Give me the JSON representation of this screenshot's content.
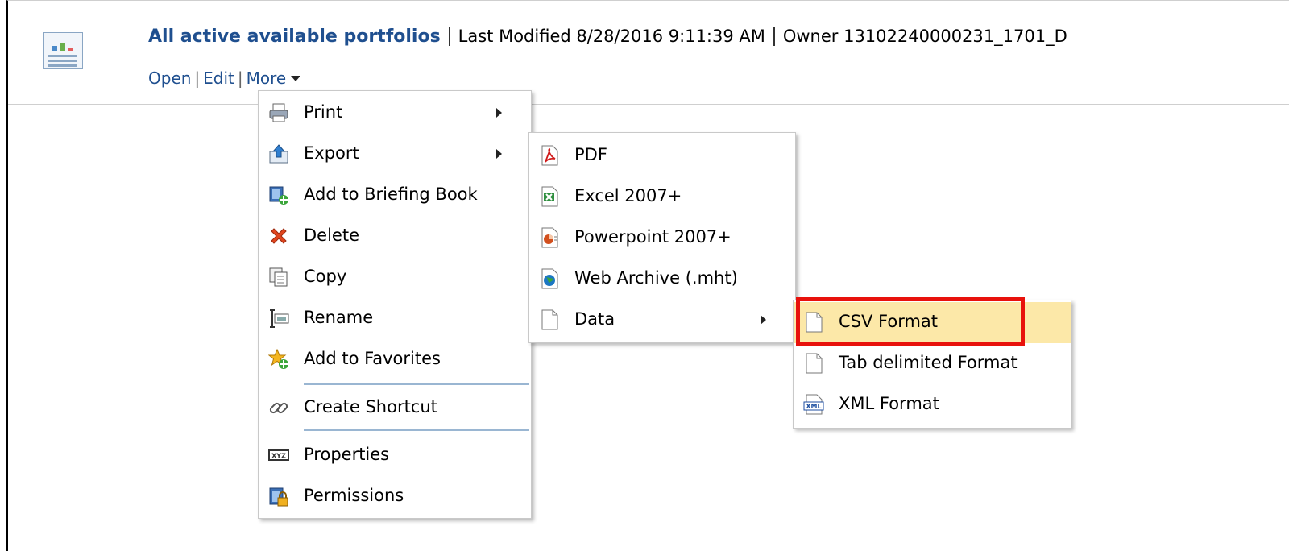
{
  "header": {
    "title": "All active available portfolios",
    "last_modified": "Last Modified 8/28/2016 9:11:39 AM",
    "owner": "Owner 13102240000231_1701_D",
    "links": {
      "open": "Open",
      "edit": "Edit",
      "more": "More"
    }
  },
  "menu": {
    "items": [
      {
        "label": "Print",
        "icon": "printer-icon",
        "submenu": true
      },
      {
        "label": "Export",
        "icon": "export-icon",
        "submenu": true
      },
      {
        "label": "Add to Briefing Book",
        "icon": "briefing-book-icon"
      },
      {
        "label": "Delete",
        "icon": "delete-icon"
      },
      {
        "label": "Copy",
        "icon": "copy-icon"
      },
      {
        "label": "Rename",
        "icon": "rename-icon"
      },
      {
        "label": "Add to Favorites",
        "icon": "favorites-icon"
      },
      {
        "label": "Create Shortcut",
        "icon": "shortcut-icon"
      },
      {
        "label": "Properties",
        "icon": "properties-icon"
      },
      {
        "label": "Permissions",
        "icon": "permissions-icon"
      }
    ]
  },
  "export_menu": {
    "items": [
      {
        "label": "PDF",
        "icon": "pdf-icon"
      },
      {
        "label": "Excel 2007+",
        "icon": "excel-icon"
      },
      {
        "label": "Powerpoint 2007+",
        "icon": "powerpoint-icon"
      },
      {
        "label": "Web Archive (.mht)",
        "icon": "web-archive-icon"
      },
      {
        "label": "Data",
        "icon": "data-file-icon",
        "submenu": true
      }
    ]
  },
  "data_menu": {
    "items": [
      {
        "label": "CSV Format",
        "icon": "csv-file-icon",
        "highlighted": true
      },
      {
        "label": "Tab delimited Format",
        "icon": "tab-file-icon"
      },
      {
        "label": "XML Format",
        "icon": "xml-file-icon"
      }
    ]
  },
  "colors": {
    "link": "#1f4f8f",
    "highlight": "#fce8a8",
    "annotation": "#e8120c"
  }
}
